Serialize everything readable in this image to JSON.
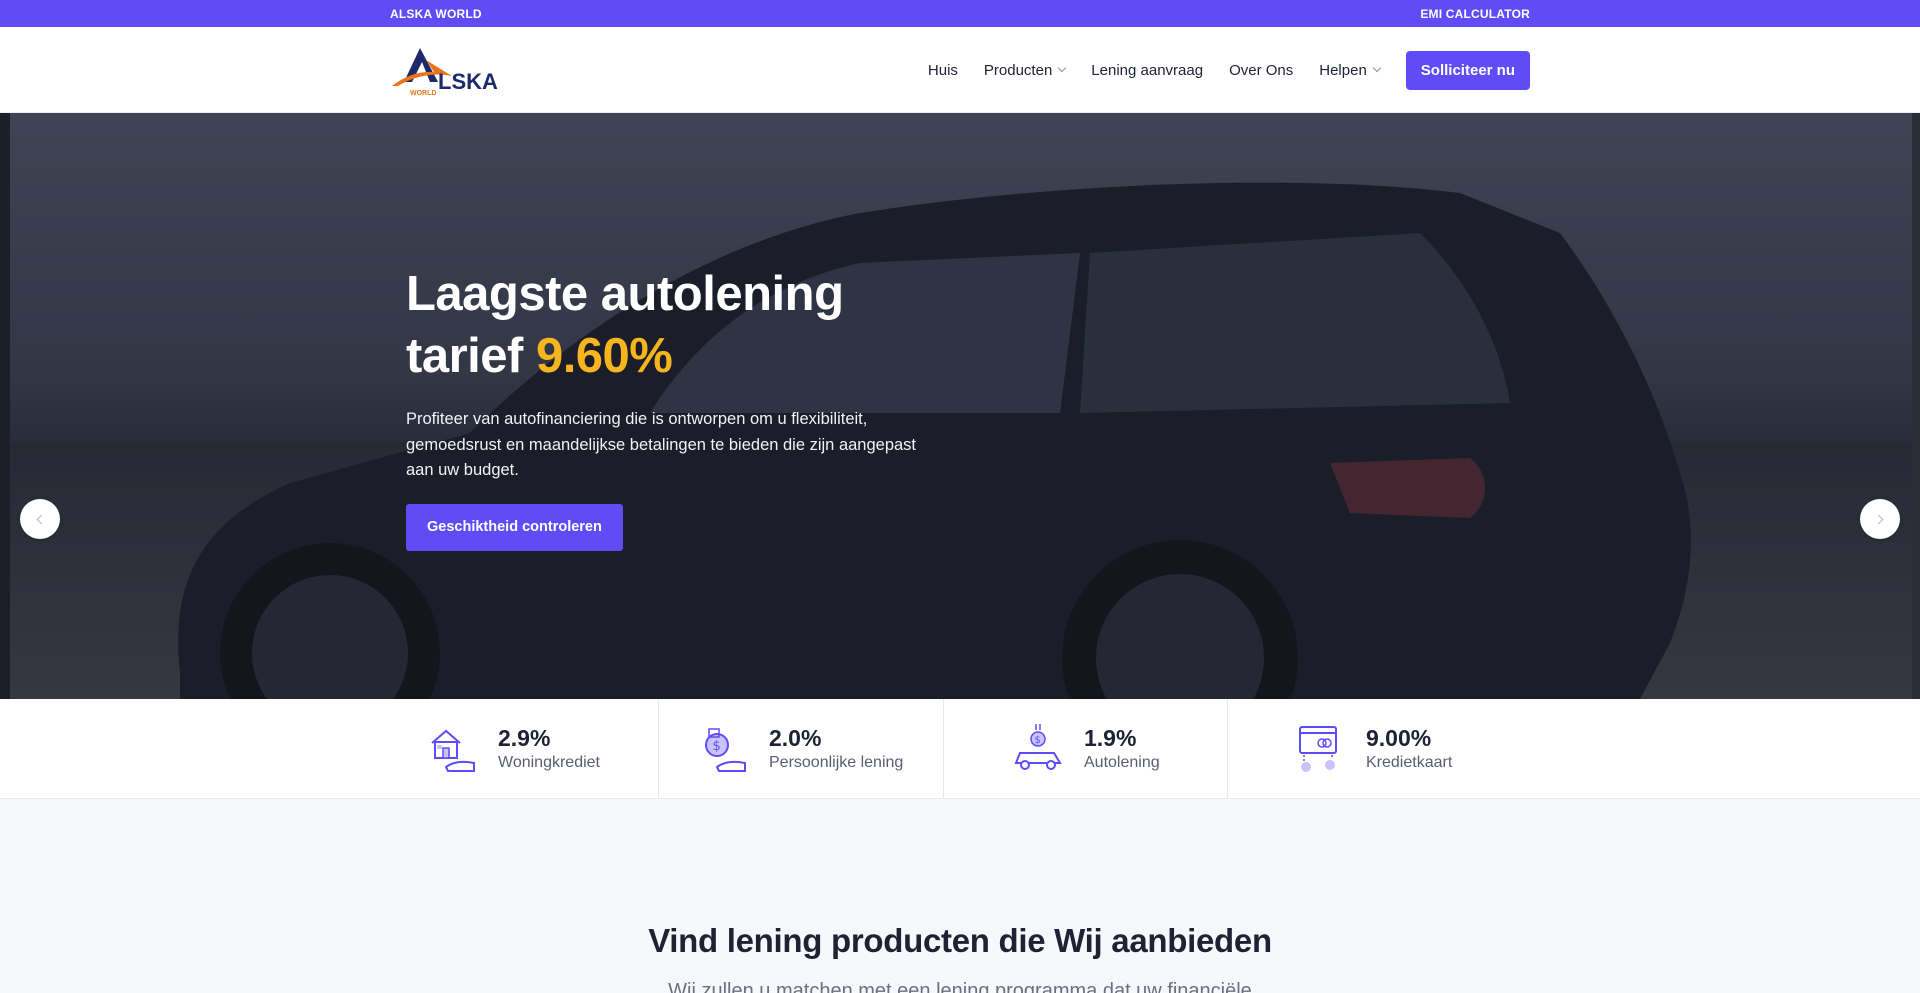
{
  "topbar": {
    "left": "ALSKA WORLD",
    "right": "EMI CALCULATOR"
  },
  "logo": {
    "wordmark": "LSKA",
    "subword": "WORLD"
  },
  "nav": {
    "items": [
      {
        "label": "Huis",
        "dropdown": false
      },
      {
        "label": "Producten",
        "dropdown": true
      },
      {
        "label": "Lening aanvraag",
        "dropdown": false
      },
      {
        "label": "Over Ons",
        "dropdown": false
      },
      {
        "label": "Helpen",
        "dropdown": true
      }
    ],
    "cta": "Solliciteer nu"
  },
  "hero": {
    "title_line1": "Laagste autolening",
    "title_line2": "tarief ",
    "rate": "9.60%",
    "text": "Profiteer van autofinanciering die is ontworpen om u flexibiliteit, gemoedsrust en maandelijkse betalingen te bieden die zijn aangepast aan uw budget.",
    "button": "Geschiktheid controleren"
  },
  "stats": [
    {
      "icon": "house-hand-icon",
      "value": "2.9%",
      "label": "Woningkrediet"
    },
    {
      "icon": "money-bag-hand-icon",
      "value": "2.0%",
      "label": "Persoonlijke lening"
    },
    {
      "icon": "car-dollar-icon",
      "value": "1.9%",
      "label": "Autolening"
    },
    {
      "icon": "credit-card-icon",
      "value": "9.00%",
      "label": "Kredietkaart"
    }
  ],
  "products": {
    "title": "Vind lening producten die Wij aanbieden",
    "subtitle": "Wij zullen u matchen met een lening programma dat uw financiële"
  },
  "colors": {
    "brand": "#5f4cf7",
    "rate": "#f6b51e",
    "text": "#1f2233"
  }
}
